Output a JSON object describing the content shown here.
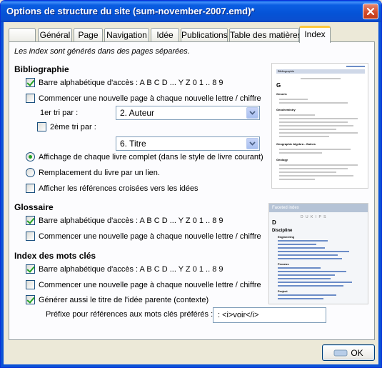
{
  "window": {
    "title": "Options de structure du site (sum-november-2007.emd)*"
  },
  "tabs": [
    {
      "label": ""
    },
    {
      "label": "Général"
    },
    {
      "label": "Page"
    },
    {
      "label": "Navigation"
    },
    {
      "label": "Idée"
    },
    {
      "label": "Publications"
    },
    {
      "label": "Table des matières"
    },
    {
      "label": "Index"
    }
  ],
  "intro": "Les index sont générés dans des pages séparées.",
  "bibliography": {
    "heading": "Bibliographie",
    "alpha_bar": {
      "label": "Barre alphabétique d'accès : A B C D ... Y Z 0 1 .. 8 9",
      "checked": true
    },
    "new_page": {
      "label": "Commencer une nouvelle page à chaque nouvelle lettre / chiffre",
      "checked": false
    },
    "sort1_label": "1er tri par :",
    "sort1_value": "2. Auteur",
    "sort2_label": "2ème tri par :",
    "sort2_checked": false,
    "sort2_value": "6. Titre",
    "radio_full": {
      "label": "Affichage de chaque livre complet (dans le style de livre courant)",
      "checked": true
    },
    "radio_link": {
      "label": "Remplacement du livre par un lien.",
      "checked": false
    },
    "cross_refs": {
      "label": "Afficher les références croisées vers les idées",
      "checked": false
    }
  },
  "glossary": {
    "heading": "Glossaire",
    "alpha_bar": {
      "label": "Barre alphabétique d'accès : A B C D ... Y Z 0 1 .. 8 9",
      "checked": true
    },
    "new_page": {
      "label": "Commencer une nouvelle page à chaque nouvelle lettre / chiffre",
      "checked": false
    }
  },
  "keywords": {
    "heading": "Index des mots clés",
    "alpha_bar": {
      "label": "Barre alphabétique d'accès : A B C D ... Y Z 0 1 .. 8 9",
      "checked": true
    },
    "new_page": {
      "label": "Commencer une nouvelle page à chaque nouvelle lettre / chiffre",
      "checked": false
    },
    "parent_title": {
      "label": "Générer aussi le titre de l'idée parente (contexte)",
      "checked": true
    },
    "prefix_label": "Préfixe pour références aux mots clés préférés :",
    "prefix_value": ": <i>voir</i>"
  },
  "preview_bib": {
    "header": "Bibliographie",
    "letter": "G",
    "sections": [
      "Generic",
      "Geochemistry",
      "Geographic Algebra - Gaines",
      "Geology"
    ]
  },
  "preview_faceted": {
    "header": "Faceted index",
    "nav": "D U K I P S",
    "letter": "D",
    "heading": "Discipline",
    "subheads": [
      "Engineering",
      "Process",
      "Project"
    ]
  },
  "buttons": {
    "ok": "OK"
  }
}
